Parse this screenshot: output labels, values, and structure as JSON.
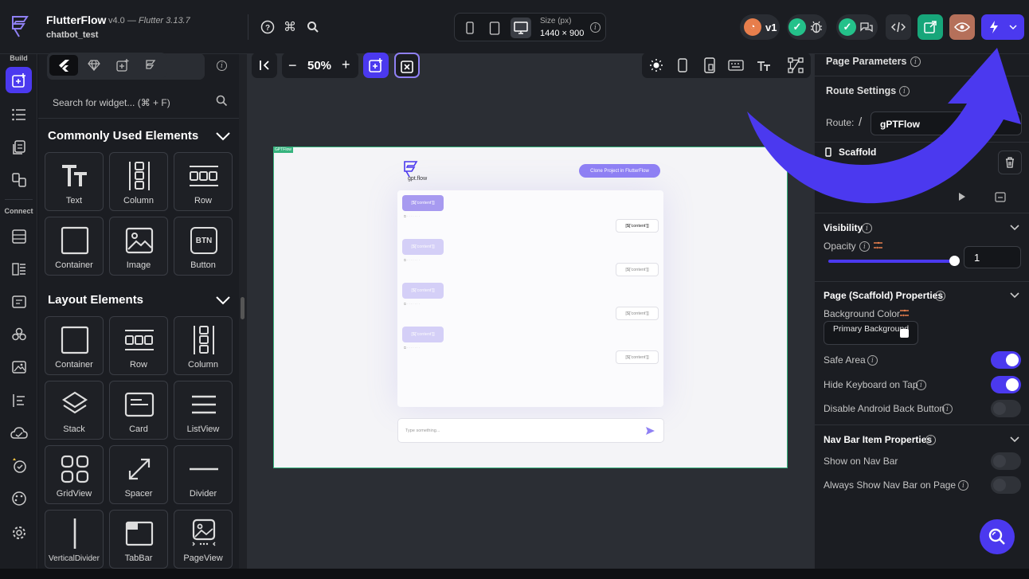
{
  "app": {
    "title": "FlutterFlow",
    "version": "v4.0",
    "flutter_version": "Flutter 3.13.7",
    "project": "chatbot_test"
  },
  "device_bar": {
    "size_label": "Size (px)",
    "size_value": "1440 × 900"
  },
  "top_actions": {
    "version_label": "v1"
  },
  "rail": {
    "build_label": "Build",
    "connect_label": "Connect"
  },
  "widget_panel": {
    "search_placeholder": "Search for widget... (⌘ + F)",
    "sections": [
      {
        "title": "Commonly Used Elements",
        "items": [
          "Text",
          "Column",
          "Row",
          "Container",
          "Image",
          "Button"
        ]
      },
      {
        "title": "Layout Elements",
        "items": [
          "Container",
          "Row",
          "Column",
          "Stack",
          "Card",
          "ListView",
          "GridView",
          "Spacer",
          "Divider",
          "VerticalDivider",
          "TabBar",
          "PageView"
        ]
      }
    ],
    "button_glyph": "BTN"
  },
  "canvas": {
    "zoom": "50%",
    "frame_tag": "GPTFlow",
    "preview": {
      "logo_text": "gpt.flow",
      "clone_button": "Clone Project in FlutterFlow",
      "bubble_text": "[$['content']]",
      "input_placeholder": "Type something..."
    }
  },
  "right_panel": {
    "page_parameters": "Page Parameters",
    "route_settings": "Route Settings",
    "route_label": "Route:",
    "route_slash": "/",
    "route_value": "gPTFlow",
    "scaffold_label": "Scaffold",
    "page_name": "GPTFlow",
    "visibility": "Visibility",
    "opacity_label": "Opacity",
    "opacity_value": "1",
    "opacity_level": 1.0,
    "page_props": "Page (Scaffold) Properties",
    "bg_color_label": "Background Color",
    "bg_color_value": "Primary Background",
    "safe_area": "Safe Area",
    "hide_keyboard": "Hide Keyboard on Tap",
    "disable_back": "Disable Android Back Button",
    "nav_bar_props": "Nav Bar Item Properties",
    "show_nav": "Show on Nav Bar",
    "always_show_nav": "Always Show Nav Bar on Page"
  },
  "colors": {
    "accent": "#4b39ef",
    "bg": "#1b1d22",
    "success": "#24c18a",
    "preview_accent": "#8f80f4"
  }
}
